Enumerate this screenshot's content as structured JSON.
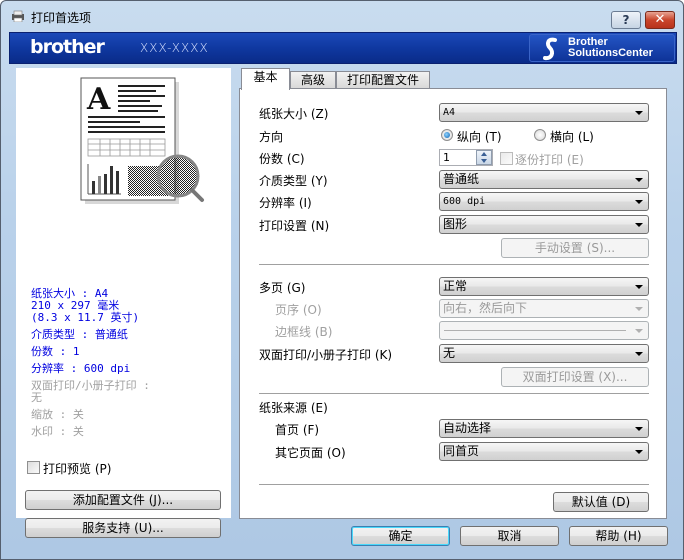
{
  "window": {
    "title": "打印首选项",
    "help_label": "?",
    "close_label": "✕"
  },
  "banner": {
    "brand": "brother",
    "model": "XXX-XXXX",
    "solutions_line1": "Brother",
    "solutions_line2": "SolutionsCenter",
    "colors": {
      "banner": "#0f38a0",
      "text": "#ffffff"
    }
  },
  "left_panel": {
    "summary": [
      {
        "text": "纸张大小 : A4",
        "style": "blue"
      },
      {
        "text": "210 x 297 毫米",
        "style": "blue"
      },
      {
        "text": "(8.3 x 11.7 英寸)",
        "style": "blue"
      },
      {
        "text": "介质类型 : 普通纸",
        "style": "blue"
      },
      {
        "text": "份数 : 1",
        "style": "blue"
      },
      {
        "text": "分辨率 : 600 dpi",
        "style": "blue"
      },
      {
        "text": "双面打印/小册子打印 :",
        "style": "gray"
      },
      {
        "text": "无",
        "style": "gray"
      },
      {
        "text": "缩放 : 关",
        "style": "gray"
      },
      {
        "text": "水印 : 关",
        "style": "gray"
      }
    ],
    "print_preview_label": "打印预览 (P)",
    "print_preview_checked": false,
    "add_profile_button": "添加配置文件 (J)...",
    "support_button": "服务支持 (U)..."
  },
  "tabs": [
    {
      "label": "基本",
      "active": true
    },
    {
      "label": "高级",
      "active": false
    },
    {
      "label": "打印配置文件",
      "active": false
    }
  ],
  "basic": {
    "paper_size": {
      "label": "纸张大小 (Z)",
      "value": "A4"
    },
    "orientation": {
      "label": "方向",
      "portrait_label": "纵向 (T)",
      "landscape_label": "横向 (L)",
      "selected": "portrait"
    },
    "copies": {
      "label": "份数 (C)",
      "value": "1",
      "collate_label": "逐份打印 (E)",
      "collate_checked": false
    },
    "media_type": {
      "label": "介质类型 (Y)",
      "value": "普通纸"
    },
    "resolution": {
      "label": "分辨率 (I)",
      "value": "600 dpi"
    },
    "print_settings": {
      "label": "打印设置 (N)",
      "value": "图形",
      "manual_button": "手动设置 (S)..."
    },
    "multiple_page": {
      "label": "多页 (G)",
      "value": "正常"
    },
    "page_order": {
      "label": "页序 (O)",
      "value": "向右，然后向下"
    },
    "border_line": {
      "label": "边框线 (B)",
      "value": ""
    },
    "duplex": {
      "label": "双面打印/小册子打印 (K)",
      "value": "无",
      "settings_button": "双面打印设置 (X)..."
    },
    "paper_source": {
      "label": "纸张来源 (E)",
      "first_page_label": "首页 (F)",
      "first_page_value": "自动选择",
      "other_pages_label": "其它页面 (O)",
      "other_pages_value": "同首页"
    },
    "default_button": "默认值 (D)"
  },
  "footer": {
    "ok": "确定",
    "cancel": "取消",
    "help": "帮助 (H)"
  }
}
